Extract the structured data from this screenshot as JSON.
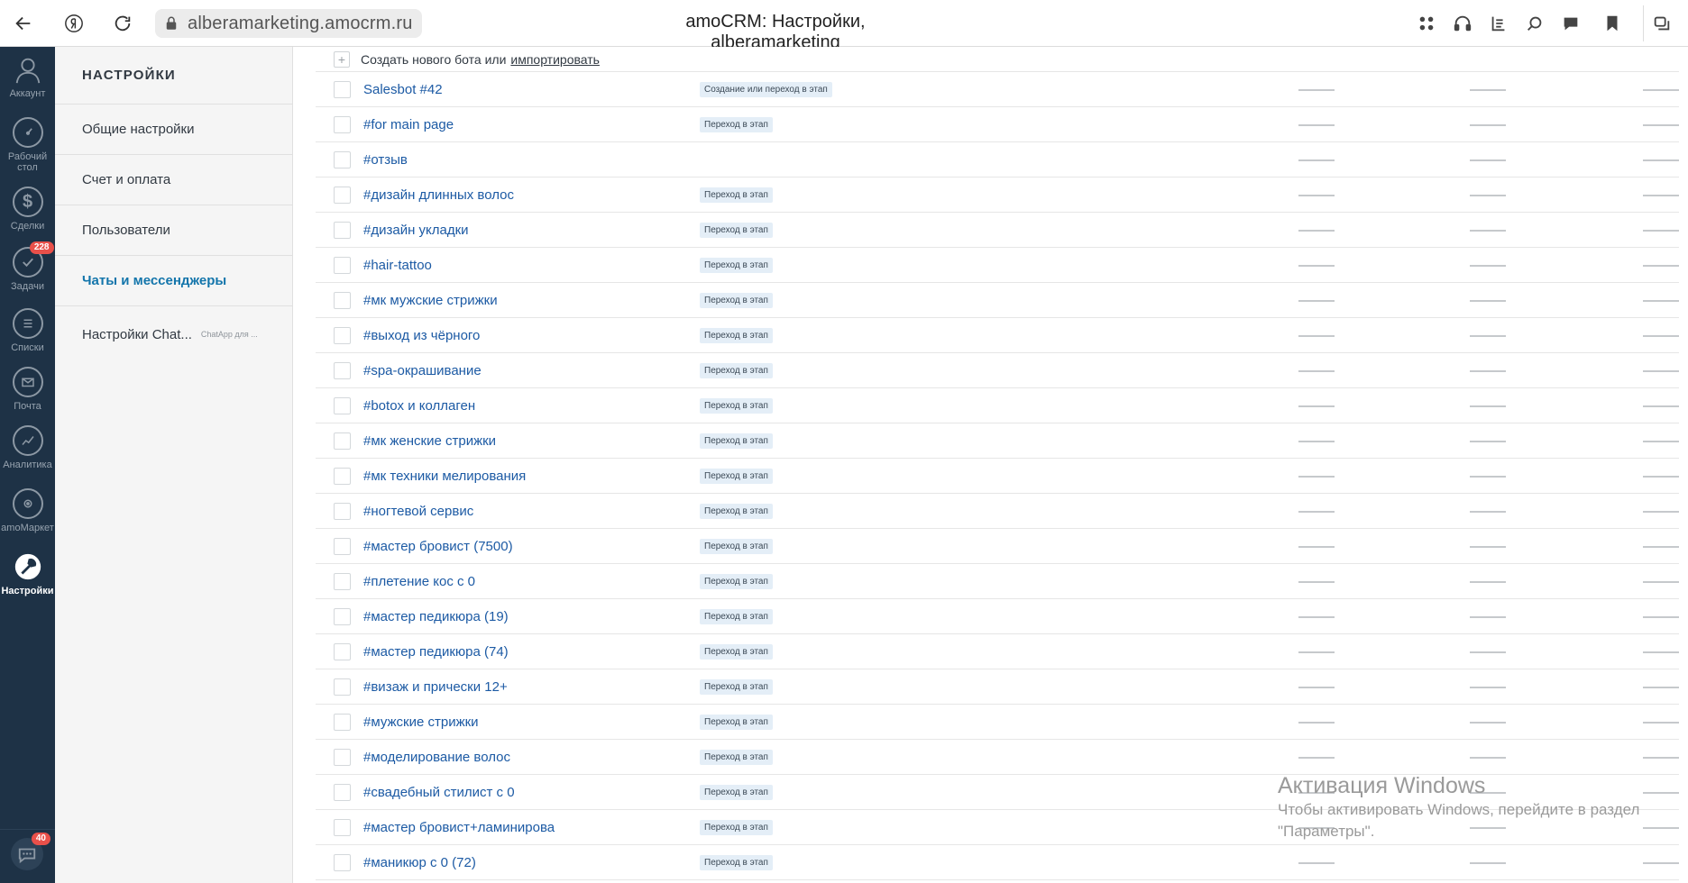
{
  "browser": {
    "url": "alberamarketing.amocrm.ru",
    "title": "amoCRM: Настройки, alberamarketing"
  },
  "nav": {
    "items": [
      {
        "label": "Аккаунт",
        "icon": "account-icon"
      },
      {
        "label": "Рабочий стол",
        "icon": "dashboard-icon"
      },
      {
        "label": "Сделки",
        "icon": "deals-icon"
      },
      {
        "label": "Задачи",
        "icon": "tasks-icon",
        "badge": "228"
      },
      {
        "label": "Списки",
        "icon": "lists-icon"
      },
      {
        "label": "Почта",
        "icon": "mail-icon"
      },
      {
        "label": "Аналитика",
        "icon": "analytics-icon"
      },
      {
        "label": "amoМаркет",
        "icon": "amomarket-icon"
      },
      {
        "label": "Настройки",
        "icon": "settings-icon"
      }
    ],
    "chat_badge": "40"
  },
  "settings": {
    "title": "НАСТРОЙКИ",
    "items": [
      {
        "label": "Общие настройки"
      },
      {
        "label": "Счет и оплата"
      },
      {
        "label": "Пользователи"
      },
      {
        "label": "Чаты и мессенджеры"
      },
      {
        "label": "Настройки Chat...",
        "sub": "ChatApp для ..."
      }
    ]
  },
  "main": {
    "create_text": "Создать нового бота или",
    "create_link": "импортировать",
    "rows": [
      {
        "name": "Salesbot #42",
        "trigger": "Создание или переход в этап"
      },
      {
        "name": "#for main page",
        "trigger": "Переход в этап"
      },
      {
        "name": "#отзыв",
        "trigger": ""
      },
      {
        "name": "#дизайн длинных волос",
        "trigger": "Переход в этап"
      },
      {
        "name": "#дизайн укладки",
        "trigger": "Переход в этап"
      },
      {
        "name": "#hair-tattoo",
        "trigger": "Переход в этап"
      },
      {
        "name": "#мк мужские стрижки",
        "trigger": "Переход в этап"
      },
      {
        "name": "#выход из чёрного",
        "trigger": "Переход в этап"
      },
      {
        "name": "#spa-окрашивание",
        "trigger": "Переход в этап"
      },
      {
        "name": "#botox и коллаген",
        "trigger": "Переход в этап"
      },
      {
        "name": "#мк женские стрижки",
        "trigger": "Переход в этап"
      },
      {
        "name": "#мк техники мелирования",
        "trigger": "Переход в этап"
      },
      {
        "name": "#ногтевой сервис",
        "trigger": "Переход в этап"
      },
      {
        "name": "#мастер бровист (7500)",
        "trigger": "Переход в этап"
      },
      {
        "name": "#плетение кос с 0",
        "trigger": "Переход в этап"
      },
      {
        "name": "#мастер педикюра (19)",
        "trigger": "Переход в этап"
      },
      {
        "name": "#мастер педикюра (74)",
        "trigger": "Переход в этап"
      },
      {
        "name": "#визаж и прически 12+",
        "trigger": "Переход в этап"
      },
      {
        "name": "#мужские стрижки",
        "trigger": "Переход в этап"
      },
      {
        "name": "#моделирование волос",
        "trigger": "Переход в этап"
      },
      {
        "name": "#свадебный стилист с 0",
        "trigger": "Переход в этап"
      },
      {
        "name": "#мастер бровист+ламинирова",
        "trigger": "Переход в этап"
      },
      {
        "name": "#маникюр с 0 (72)",
        "trigger": "Переход в этап"
      }
    ]
  },
  "watermark": {
    "title": "Активация Windows",
    "subtitle": "Чтобы активировать Windows, перейдите в раздел \"Параметры\"."
  }
}
